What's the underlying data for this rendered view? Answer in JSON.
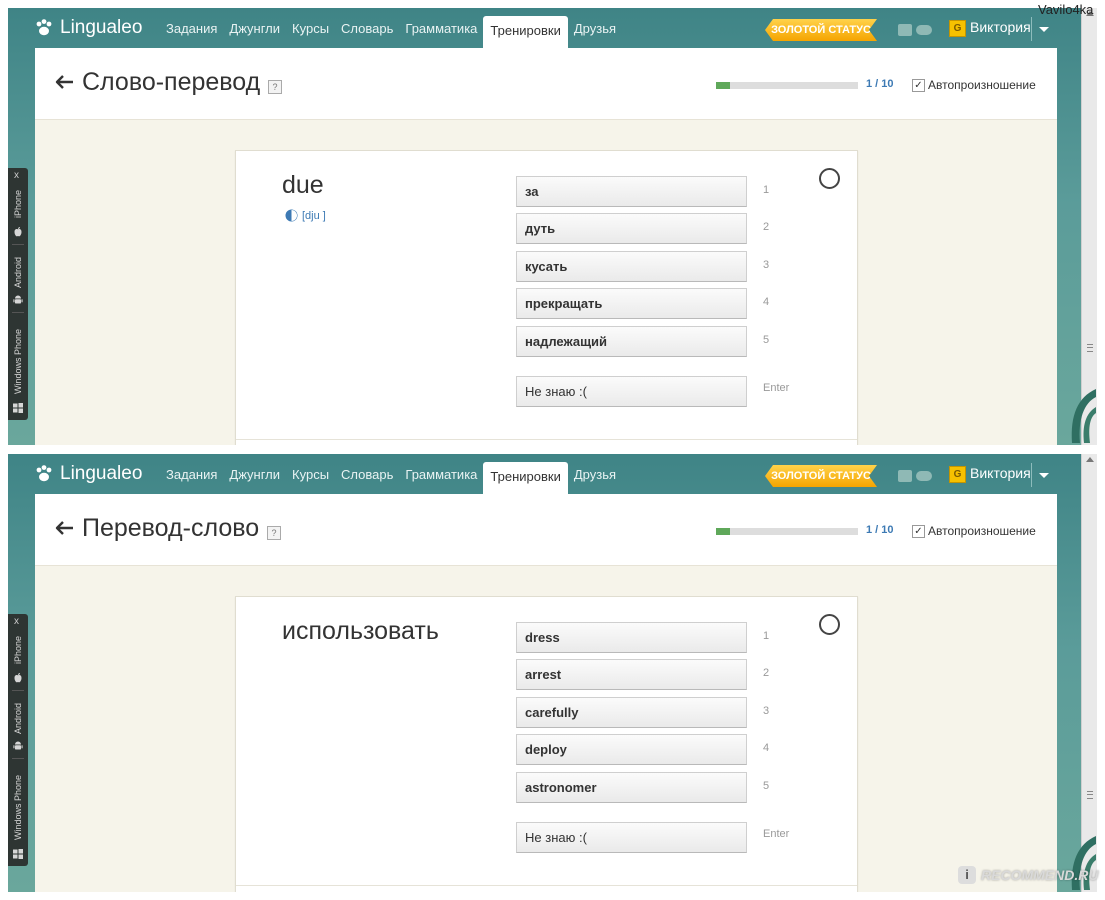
{
  "watermark_user": "Vavilo4ka",
  "recommend": {
    "badge": "i",
    "text": "RECOMMEND.RU"
  },
  "header": {
    "logo": "Lingualeo",
    "nav": [
      "Задания",
      "Джунгли",
      "Курсы",
      "Словарь",
      "Грамматика",
      "Тренировки",
      "Друзья"
    ],
    "active_nav": "Тренировки",
    "gold_status": "ЗОЛОТОЙ СТАТУС",
    "gold_icon_letter": "G",
    "user": "Виктория"
  },
  "side_panel": {
    "close": "x",
    "items": [
      "iPhone",
      "Android",
      "Windows Phone"
    ]
  },
  "colors": {
    "teal_bg": "#4a8c8e",
    "gold": "#f5a400",
    "progress_fill": "#5fa85a",
    "link_blue": "#3d7ab4"
  },
  "icons": [
    "paw-logo-icon",
    "back-arrow-icon",
    "help-icon",
    "speaker-icon",
    "checkbox-icon",
    "caret-down-icon",
    "apple-icon",
    "android-icon",
    "windows-icon"
  ],
  "trainings": [
    {
      "title": "Слово-перевод",
      "help": "?",
      "progress_text": "1 / 10",
      "progress_fraction": 0.1,
      "autoplay_label": "Автопроизношение",
      "autoplay_checked": true,
      "word": "due",
      "transcription": "[dju ]",
      "options": [
        {
          "label": "за",
          "key": "1"
        },
        {
          "label": "дуть",
          "key": "2"
        },
        {
          "label": "кусать",
          "key": "3"
        },
        {
          "label": "прекращать",
          "key": "4"
        },
        {
          "label": "надлежащий",
          "key": "5"
        }
      ],
      "dont_know": {
        "label": "Не знаю :(",
        "key": "Enter"
      }
    },
    {
      "title": "Перевод-слово",
      "help": "?",
      "progress_text": "1 / 10",
      "progress_fraction": 0.1,
      "autoplay_label": "Автопроизношение",
      "autoplay_checked": true,
      "word": "использовать",
      "transcription": "",
      "options": [
        {
          "label": "dress",
          "key": "1"
        },
        {
          "label": "arrest",
          "key": "2"
        },
        {
          "label": "carefully",
          "key": "3"
        },
        {
          "label": "deploy",
          "key": "4"
        },
        {
          "label": "astronomer",
          "key": "5"
        }
      ],
      "dont_know": {
        "label": "Не знаю :(",
        "key": "Enter"
      }
    }
  ]
}
